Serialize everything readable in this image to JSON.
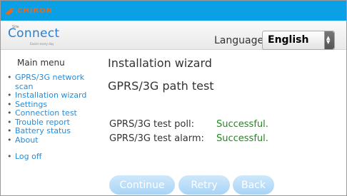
{
  "header": {
    "brand": "CHIRON"
  },
  "logo": {
    "site": "Site",
    "brand": "Connect",
    "tagline": "Easier every day"
  },
  "language": {
    "label": "Language:",
    "selected": "English"
  },
  "sidebar": {
    "title": "Main menu",
    "items": [
      {
        "label": "GPRS/3G network scan"
      },
      {
        "label": "Installation wizard"
      },
      {
        "label": "Settings"
      },
      {
        "label": "Connection test"
      },
      {
        "label": "Trouble report"
      },
      {
        "label": "Battery status"
      },
      {
        "label": "About"
      }
    ],
    "logoff": "Log off"
  },
  "main": {
    "title": "Installation wizard",
    "subtitle": "GPRS/3G path test",
    "results": [
      {
        "label": "GPRS/3G test poll:",
        "value": "Successful."
      },
      {
        "label": "GPRS/3G test alarm:",
        "value": "Successful."
      }
    ],
    "buttons": {
      "continue": "Continue",
      "retry": "Retry",
      "back": "Back"
    }
  },
  "colors": {
    "topbar": "#0aa0e6",
    "link": "#2a8bd6",
    "success": "#1d8a1d",
    "button": "#a9d4f6"
  }
}
